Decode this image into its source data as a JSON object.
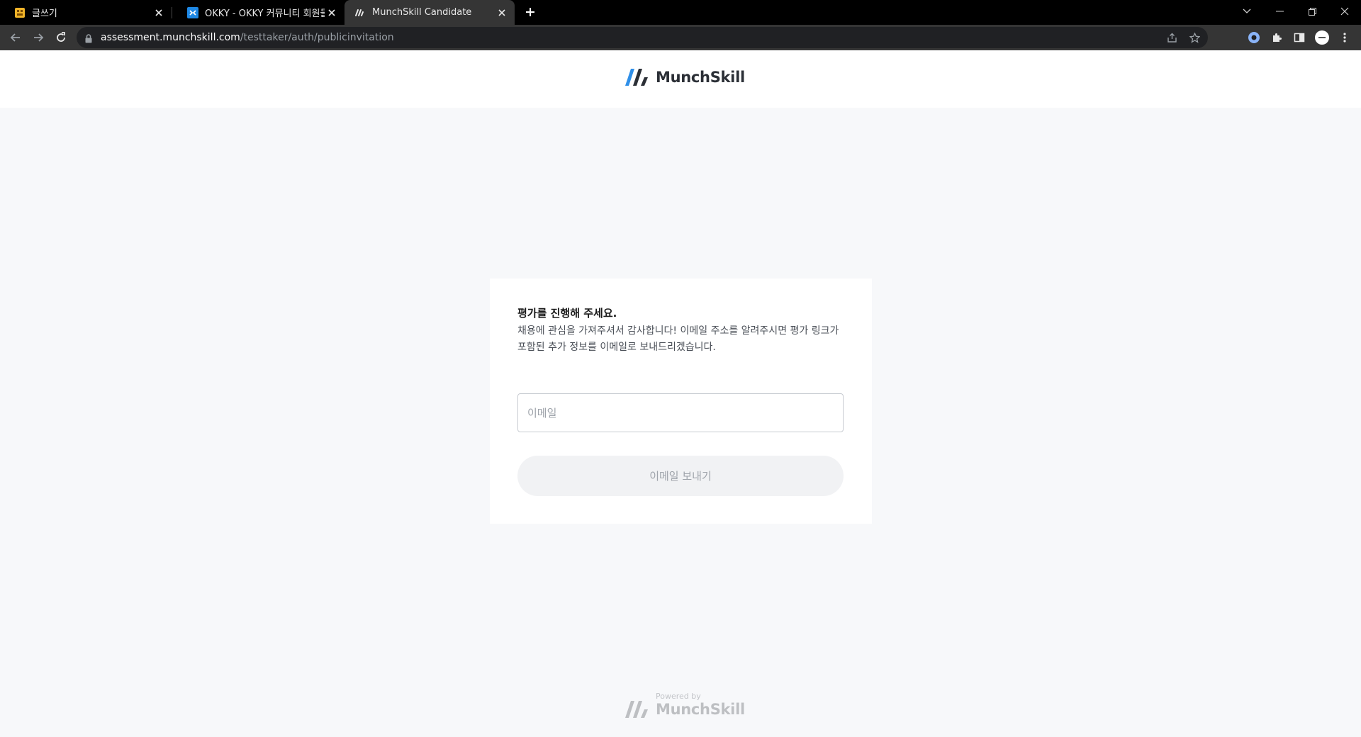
{
  "browser": {
    "tabs": [
      {
        "title": "글쓰기",
        "favicon": "writing-favicon",
        "active": false
      },
      {
        "title": "OKKY - OKKY 커뮤니티 회원들과",
        "favicon": "okky-favicon",
        "active": false
      },
      {
        "title": "MunchSkill Candidate",
        "favicon": "munchskill-favicon",
        "active": true
      }
    ],
    "url_host": "assessment.munchskill.com",
    "url_path": "/testtaker/auth/publicinvitation"
  },
  "header": {
    "brand": "MunchSkill"
  },
  "card": {
    "title": "평가를 진행해 주세요.",
    "description": "채용에 관심을 가져주셔서 감사합니다! 이메일 주소를 알려주시면 평가 링크가 포함된 추가 정보를 이메일로 보내드리겠습니다.",
    "email_placeholder": "이메일",
    "email_value": "",
    "send_button": "이메일 보내기"
  },
  "footer": {
    "powered_by": "Powered by",
    "brand": "MunchSkill"
  },
  "colors": {
    "brand_blue": "#1e88e5",
    "brand_dark": "#2b2f36",
    "page_bg": "#f7f8fa",
    "button_disabled_bg": "#f1f2f4"
  }
}
